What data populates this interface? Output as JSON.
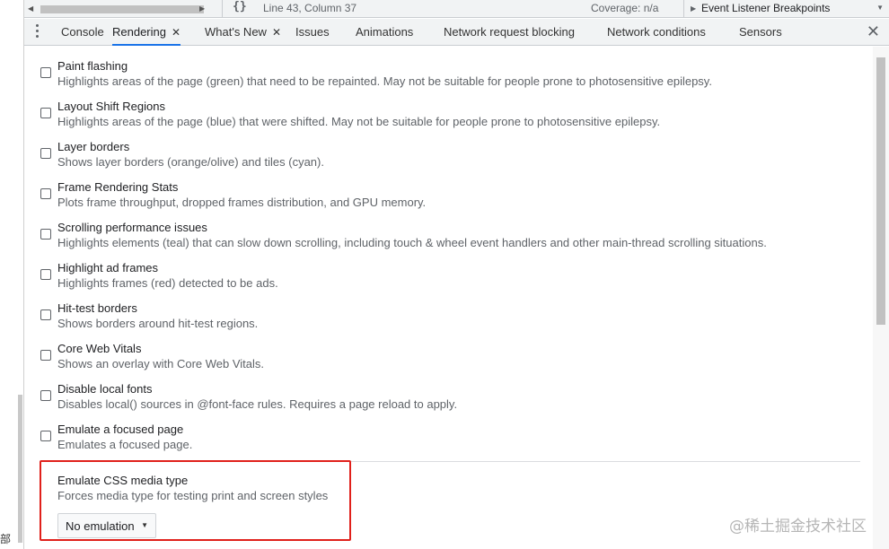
{
  "left_glyph": "部",
  "topbar": {
    "brace": "{}",
    "cursor_position": "Line 43, Column 37",
    "coverage": "Coverage: n/a",
    "breakpoints_label": "Event Listener Breakpoints"
  },
  "tabs": [
    {
      "label": "Console"
    },
    {
      "label": "Rendering",
      "active": true,
      "closable": true
    },
    {
      "label": "What's New",
      "closable": true
    },
    {
      "label": "Issues"
    },
    {
      "label": "Animations"
    },
    {
      "label": "Network request blocking"
    },
    {
      "label": "Network conditions"
    },
    {
      "label": "Sensors"
    }
  ],
  "tab_close_glyph": "✕",
  "options": [
    {
      "title": "Paint flashing",
      "desc": "Highlights areas of the page (green) that need to be repainted. May not be suitable for people prone to photosensitive epilepsy.",
      "checked": false
    },
    {
      "title": "Layout Shift Regions",
      "desc": "Highlights areas of the page (blue) that were shifted. May not be suitable for people prone to photosensitive epilepsy.",
      "checked": false
    },
    {
      "title": "Layer borders",
      "desc": "Shows layer borders (orange/olive) and tiles (cyan).",
      "checked": false
    },
    {
      "title": "Frame Rendering Stats",
      "desc": "Plots frame throughput, dropped frames distribution, and GPU memory.",
      "checked": false
    },
    {
      "title": "Scrolling performance issues",
      "desc": "Highlights elements (teal) that can slow down scrolling, including touch & wheel event handlers and other main-thread scrolling situations.",
      "checked": false
    },
    {
      "title": "Highlight ad frames",
      "desc": "Highlights frames (red) detected to be ads.",
      "checked": false
    },
    {
      "title": "Hit-test borders",
      "desc": "Shows borders around hit-test regions.",
      "checked": false
    },
    {
      "title": "Core Web Vitals",
      "desc": "Shows an overlay with Core Web Vitals.",
      "checked": false
    },
    {
      "title": "Disable local fonts",
      "desc": "Disables local() sources in @font-face rules. Requires a page reload to apply.",
      "checked": false
    },
    {
      "title": "Emulate a focused page",
      "desc": "Emulates a focused page.",
      "checked": false
    }
  ],
  "media_type": {
    "title": "Emulate CSS media type",
    "desc": "Forces media type for testing print and screen styles",
    "selected": "No emulation"
  },
  "watermark": "@稀土掘金技术社区",
  "colors": {
    "accent": "#1a73e8",
    "highlight_box": "#e0201b",
    "toolbar_bg": "#f1f3f4"
  }
}
